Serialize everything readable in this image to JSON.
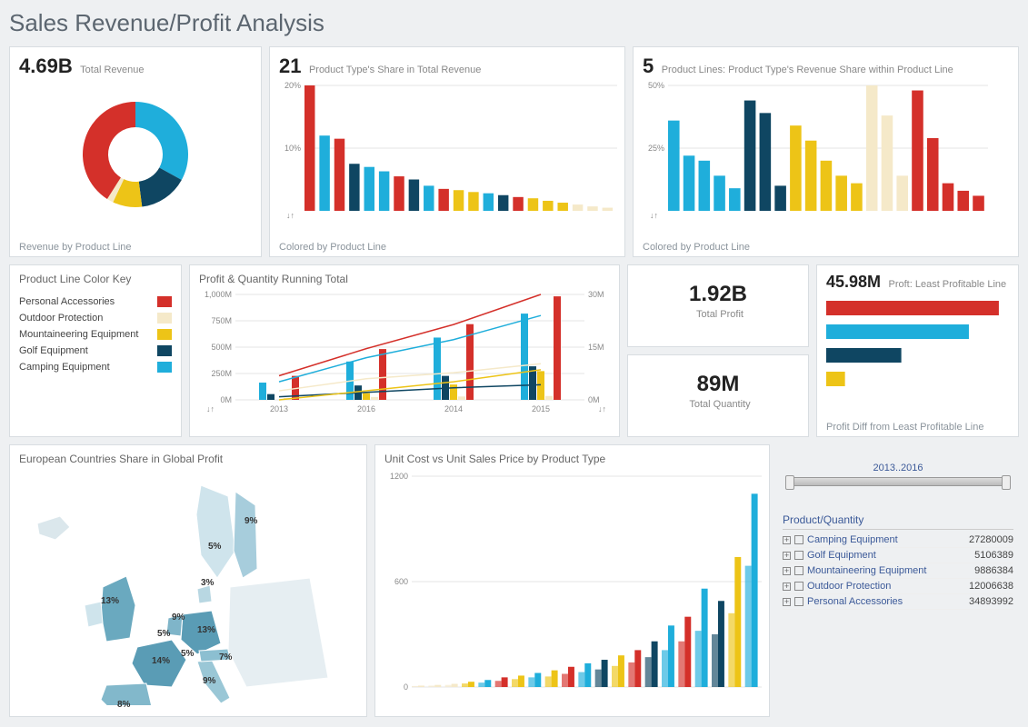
{
  "page_title": "Sales Revenue/Profit Analysis",
  "colors": {
    "red": "#d4302a",
    "cream": "#f5e9c9",
    "gold": "#edc417",
    "navy": "#0f4662",
    "cyan": "#1faedb"
  },
  "legend": {
    "title": "Product Line Color Key",
    "items": [
      {
        "label": "Personal Accessories",
        "color": "red"
      },
      {
        "label": "Outdoor Protection",
        "color": "cream"
      },
      {
        "label": "Mountaineering Equipment",
        "color": "gold"
      },
      {
        "label": "Golf Equipment",
        "color": "navy"
      },
      {
        "label": "Camping Equipment",
        "color": "cyan"
      }
    ]
  },
  "card1": {
    "metric": "4.69B",
    "label": "Total Revenue",
    "caption": "Revenue by Product Line"
  },
  "card2": {
    "metric": "21",
    "label": "Product Type's Share in Total Revenue",
    "caption": "Colored by Product Line"
  },
  "card3": {
    "metric": "5",
    "label": "Product Lines: Product Type's Revenue Share within Product Line",
    "caption": "Colored by Product Line"
  },
  "card_profit_running": {
    "title": "Profit & Quantity Running Total"
  },
  "kpi_profit": {
    "metric": "1.92B",
    "label": "Total Profit"
  },
  "kpi_qty": {
    "metric": "89M",
    "label": "Total Quantity"
  },
  "card_profit_diff": {
    "metric": "45.98M",
    "label": "Proft: Least Profitable Line",
    "caption": "Profit Diff from Least Profitable Line"
  },
  "card_map": {
    "title": "European Countries Share in Global Profit"
  },
  "card_scatter": {
    "title": "Unit Cost vs Unit Sales Price by Product Type"
  },
  "slider": {
    "label": "2013..2016"
  },
  "product_quantity": {
    "title": "Product/Quantity",
    "rows": [
      {
        "label": "Camping Equipment",
        "value": "27280009"
      },
      {
        "label": "Golf Equipment",
        "value": "5106389"
      },
      {
        "label": "Mountaineering Equipment",
        "value": "9886384"
      },
      {
        "label": "Outdoor Protection",
        "value": "12006638"
      },
      {
        "label": "Personal Accessories",
        "value": "34893992"
      }
    ]
  },
  "chart_data": [
    {
      "type": "pie",
      "title": "Revenue by Product Line",
      "total": "4.69B",
      "slices": [
        {
          "name": "Camping Equipment",
          "value": 33,
          "color": "cyan"
        },
        {
          "name": "Golf Equipment",
          "value": 15,
          "color": "navy"
        },
        {
          "name": "Mountaineering Equipment",
          "value": 9,
          "color": "gold"
        },
        {
          "name": "Outdoor Protection",
          "value": 2,
          "color": "cream"
        },
        {
          "name": "Personal Accessories",
          "value": 41,
          "color": "red"
        }
      ]
    },
    {
      "type": "bar",
      "title": "Product Type's Share in Total Revenue",
      "ylabel": "%",
      "ylim": [
        0,
        20
      ],
      "series": [
        {
          "value": 20,
          "color": "red"
        },
        {
          "value": 12,
          "color": "cyan"
        },
        {
          "value": 11.5,
          "color": "red"
        },
        {
          "value": 7.5,
          "color": "navy"
        },
        {
          "value": 7,
          "color": "cyan"
        },
        {
          "value": 6.3,
          "color": "cyan"
        },
        {
          "value": 5.5,
          "color": "red"
        },
        {
          "value": 5,
          "color": "navy"
        },
        {
          "value": 4,
          "color": "cyan"
        },
        {
          "value": 3.5,
          "color": "red"
        },
        {
          "value": 3.3,
          "color": "gold"
        },
        {
          "value": 3,
          "color": "gold"
        },
        {
          "value": 2.8,
          "color": "cyan"
        },
        {
          "value": 2.5,
          "color": "navy"
        },
        {
          "value": 2.2,
          "color": "red"
        },
        {
          "value": 2,
          "color": "gold"
        },
        {
          "value": 1.6,
          "color": "gold"
        },
        {
          "value": 1.3,
          "color": "gold"
        },
        {
          "value": 1,
          "color": "cream"
        },
        {
          "value": 0.7,
          "color": "cream"
        },
        {
          "value": 0.5,
          "color": "cream"
        }
      ]
    },
    {
      "type": "bar",
      "title": "Product Type's Revenue Share within Product Line",
      "ylabel": "%",
      "ylim": [
        0,
        50
      ],
      "series": [
        {
          "value": 36,
          "color": "cyan"
        },
        {
          "value": 22,
          "color": "cyan"
        },
        {
          "value": 20,
          "color": "cyan"
        },
        {
          "value": 14,
          "color": "cyan"
        },
        {
          "value": 9,
          "color": "cyan"
        },
        {
          "value": 44,
          "color": "navy"
        },
        {
          "value": 39,
          "color": "navy"
        },
        {
          "value": 10,
          "color": "navy"
        },
        {
          "value": 34,
          "color": "gold"
        },
        {
          "value": 28,
          "color": "gold"
        },
        {
          "value": 20,
          "color": "gold"
        },
        {
          "value": 14,
          "color": "gold"
        },
        {
          "value": 11,
          "color": "gold"
        },
        {
          "value": 50,
          "color": "cream"
        },
        {
          "value": 38,
          "color": "cream"
        },
        {
          "value": 14,
          "color": "cream"
        },
        {
          "value": 48,
          "color": "red"
        },
        {
          "value": 29,
          "color": "red"
        },
        {
          "value": 11,
          "color": "red"
        },
        {
          "value": 8,
          "color": "red"
        },
        {
          "value": 6,
          "color": "red"
        }
      ]
    },
    {
      "type": "bar+line",
      "title": "Profit & Quantity Running Total",
      "categories": [
        "2013",
        "2016",
        "2014",
        "2015"
      ],
      "y1_ticks": [
        "0M",
        "250M",
        "500M",
        "750M",
        "1,000M"
      ],
      "y2_ticks": [
        "0M",
        "15M",
        "30M"
      ],
      "bar_series": [
        {
          "name": "Camping Equipment",
          "color": "cyan",
          "values": [
            180,
            400,
            650,
            900
          ]
        },
        {
          "name": "Golf Equipment",
          "color": "navy",
          "values": [
            60,
            150,
            250,
            350
          ]
        },
        {
          "name": "Mountaineering Equipment",
          "color": "gold",
          "values": [
            0,
            70,
            160,
            300
          ]
        },
        {
          "name": "Outdoor Protection",
          "color": "cream",
          "values": [
            20,
            30,
            35,
            40
          ]
        },
        {
          "name": "Personal Accessories",
          "color": "red",
          "values": [
            250,
            530,
            790,
            1080
          ]
        }
      ],
      "line_series": [
        {
          "name": "Camping Equipment",
          "color": "cyan",
          "values": [
            6,
            14,
            20,
            28
          ]
        },
        {
          "name": "Golf Equipment",
          "color": "navy",
          "values": [
            1,
            2.5,
            4,
            5
          ]
        },
        {
          "name": "Mountaineering Equipment",
          "color": "gold",
          "values": [
            0,
            3,
            6,
            10
          ]
        },
        {
          "name": "Outdoor Protection",
          "color": "cream",
          "values": [
            3,
            7,
            9,
            12
          ]
        },
        {
          "name": "Personal Accessories",
          "color": "red",
          "values": [
            8,
            17,
            25,
            35
          ]
        }
      ]
    },
    {
      "type": "bar",
      "title": "Profit Diff from Least Profitable Line",
      "orientation": "horizontal",
      "series": [
        {
          "color": "red",
          "value": 45.98
        },
        {
          "color": "cyan",
          "value": 38
        },
        {
          "color": "navy",
          "value": 20
        },
        {
          "color": "gold",
          "value": 5
        }
      ]
    },
    {
      "type": "bar",
      "title": "Unit Cost vs Unit Sales Price by Product Type",
      "ylim": [
        0,
        1200
      ],
      "y_ticks": [
        0,
        600,
        1200
      ],
      "series": [
        {
          "c": "cream",
          "a": 6,
          "b": 8
        },
        {
          "c": "cream",
          "a": 8,
          "b": 12
        },
        {
          "c": "cream",
          "a": 12,
          "b": 18
        },
        {
          "c": "gold",
          "a": 20,
          "b": 30
        },
        {
          "c": "cyan",
          "a": 25,
          "b": 40
        },
        {
          "c": "red",
          "a": 35,
          "b": 55
        },
        {
          "c": "gold",
          "a": 45,
          "b": 65
        },
        {
          "c": "cyan",
          "a": 55,
          "b": 80
        },
        {
          "c": "gold",
          "a": 60,
          "b": 95
        },
        {
          "c": "red",
          "a": 75,
          "b": 115
        },
        {
          "c": "cyan",
          "a": 85,
          "b": 135
        },
        {
          "c": "navy",
          "a": 100,
          "b": 155
        },
        {
          "c": "gold",
          "a": 120,
          "b": 180
        },
        {
          "c": "red",
          "a": 140,
          "b": 210
        },
        {
          "c": "navy",
          "a": 170,
          "b": 260
        },
        {
          "c": "cyan",
          "a": 210,
          "b": 350
        },
        {
          "c": "red",
          "a": 260,
          "b": 400
        },
        {
          "c": "cyan",
          "a": 320,
          "b": 560
        },
        {
          "c": "navy",
          "a": 300,
          "b": 490
        },
        {
          "c": "gold",
          "a": 420,
          "b": 740
        },
        {
          "c": "cyan",
          "a": 690,
          "b": 1100
        }
      ]
    },
    {
      "type": "map",
      "title": "European Countries Share in Global Profit",
      "points": [
        {
          "country": "Finland",
          "pct": "9%"
        },
        {
          "country": "Sweden",
          "pct": "5%"
        },
        {
          "country": "Denmark",
          "pct": "3%"
        },
        {
          "country": "UK",
          "pct": "13%"
        },
        {
          "country": "Netherlands",
          "pct": "9%"
        },
        {
          "country": "Germany",
          "pct": "13%"
        },
        {
          "country": "Belgium",
          "pct": "5%"
        },
        {
          "country": "France",
          "pct": "14%"
        },
        {
          "country": "Switzerland",
          "pct": "5%"
        },
        {
          "country": "Austria",
          "pct": "7%"
        },
        {
          "country": "Italy",
          "pct": "9%"
        },
        {
          "country": "Spain",
          "pct": "8%"
        }
      ]
    }
  ]
}
